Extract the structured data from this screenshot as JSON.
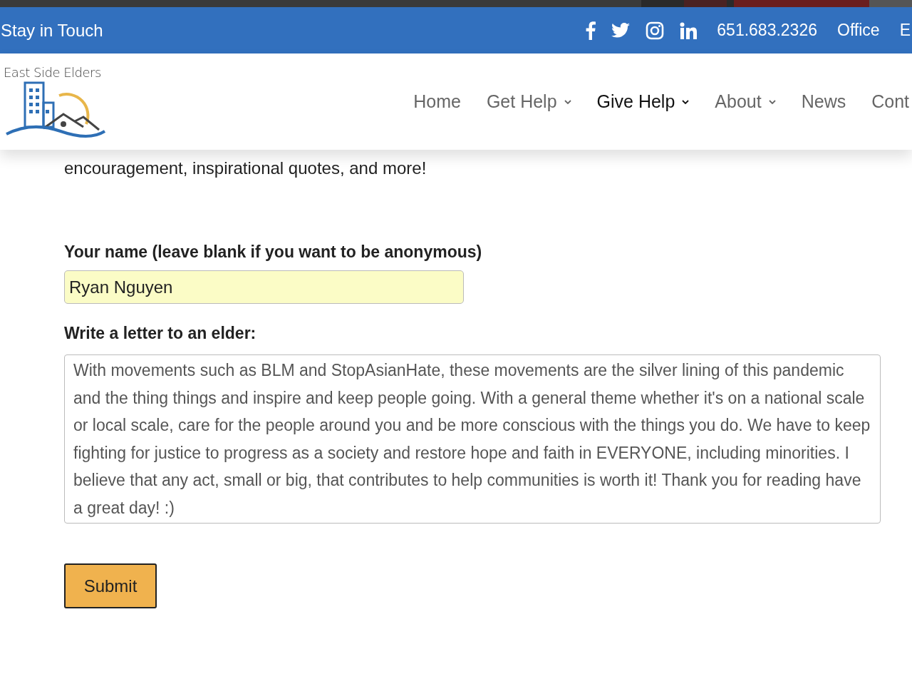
{
  "top_bar": {
    "title": "Stay in Touch",
    "social": [
      {
        "kind": "facebook"
      },
      {
        "kind": "twitter"
      },
      {
        "kind": "instagram"
      },
      {
        "kind": "linkedin"
      }
    ],
    "links": [
      "651.683.2326",
      "Office",
      "E"
    ]
  },
  "logo": {
    "text": "East Side Elders"
  },
  "nav": [
    {
      "label": "Home",
      "dropdown": false,
      "selected": false
    },
    {
      "label": "Get Help",
      "dropdown": true,
      "selected": false
    },
    {
      "label": "Give Help",
      "dropdown": true,
      "selected": true
    },
    {
      "label": "About",
      "dropdown": true,
      "selected": false
    },
    {
      "label": "News",
      "dropdown": false,
      "selected": false
    },
    {
      "label": "Cont",
      "dropdown": false,
      "selected": false
    }
  ],
  "intro": "encouragement, inspirational quotes, and more!",
  "form": {
    "name_label": "Your name (leave blank if you want to be anonymous)",
    "name_value": "Ryan Nguyen",
    "letter_label": "Write a letter to an elder:",
    "letter_value": "With movements such as BLM and StopAsianHate, these movements are the silver lining of this pandemic and the thing things and inspire and keep people going. With a general theme whether it's on a national scale or local scale, care for the people around you and be more conscious with the things you do. We have to keep fighting for justice to progress as a society and restore hope and faith in EVERYONE, including minorities. I believe that any act, small or big, that contributes to help communities is worth it! Thank you for reading have a great day! :)",
    "submit": "Submit"
  }
}
